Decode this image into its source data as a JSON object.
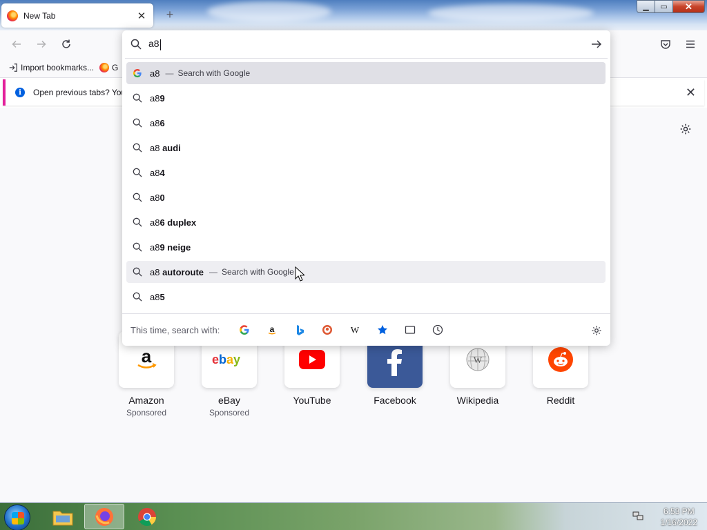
{
  "tab": {
    "title": "New Tab",
    "close": "✕",
    "new_tab": "+"
  },
  "window_controls": {
    "minimize": "▁",
    "maximize": "▭",
    "close": "✕"
  },
  "bookmarks": {
    "import_label": "Import bookmarks...",
    "item2_label": "G"
  },
  "notice": {
    "text": "Open previous tabs? You",
    "close": "✕"
  },
  "urlbar": {
    "typed": "a8",
    "rows": [
      {
        "typed": "a8",
        "suggest": "",
        "action": "Search with Google",
        "icon": "google-icon",
        "state": "selected"
      },
      {
        "typed": "a8",
        "suggest": "9",
        "action": "",
        "icon": "search-icon",
        "state": ""
      },
      {
        "typed": "a8",
        "suggest": "6",
        "action": "",
        "icon": "search-icon",
        "state": ""
      },
      {
        "typed": "a8",
        "suggest": " audi",
        "action": "",
        "icon": "search-icon",
        "state": ""
      },
      {
        "typed": "a8",
        "suggest": "4",
        "action": "",
        "icon": "search-icon",
        "state": ""
      },
      {
        "typed": "a8",
        "suggest": "0",
        "action": "",
        "icon": "search-icon",
        "state": ""
      },
      {
        "typed": "a8",
        "suggest": "6 duplex",
        "action": "",
        "icon": "search-icon",
        "state": ""
      },
      {
        "typed": "a8",
        "suggest": "9 neige",
        "action": "",
        "icon": "search-icon",
        "state": ""
      },
      {
        "typed": "a8",
        "suggest": " autoroute",
        "action": "Search with Google",
        "icon": "search-icon",
        "state": "hover"
      },
      {
        "typed": "a8",
        "suggest": "5",
        "action": "",
        "icon": "search-icon",
        "state": ""
      }
    ],
    "action_dash": "—",
    "engines_label": "This time, search with:"
  },
  "sites": [
    {
      "name": "Amazon",
      "sponsored": "Sponsored",
      "icon": "amazon-icon"
    },
    {
      "name": "eBay",
      "sponsored": "Sponsored",
      "icon": "ebay-icon"
    },
    {
      "name": "YouTube",
      "sponsored": "",
      "icon": "youtube-icon"
    },
    {
      "name": "Facebook",
      "sponsored": "",
      "icon": "facebook-icon"
    },
    {
      "name": "Wikipedia",
      "sponsored": "",
      "icon": "wikipedia-icon"
    },
    {
      "name": "Reddit",
      "sponsored": "",
      "icon": "reddit-icon"
    }
  ],
  "taskbar": {
    "time": "6:53 PM",
    "date": "1/16/2022"
  },
  "colors": {
    "accent": "#0060df",
    "notice_border": "#e3209b"
  }
}
